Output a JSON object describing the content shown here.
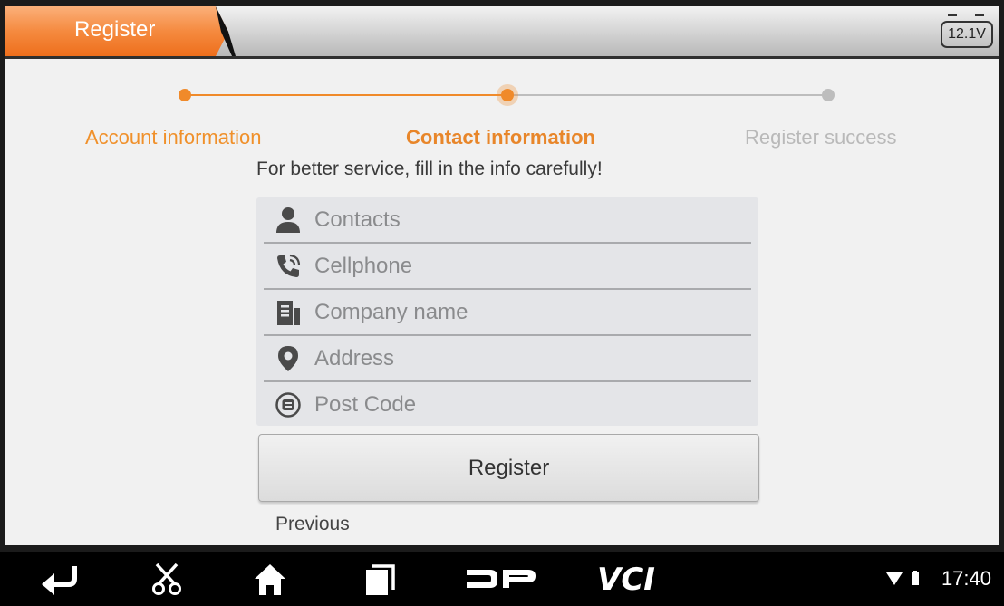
{
  "header": {
    "tab_title": "Register",
    "battery_voltage": "12.1V"
  },
  "stepper": {
    "steps": [
      {
        "label": "Account information",
        "state": "done"
      },
      {
        "label": "Contact information",
        "state": "current"
      },
      {
        "label": "Register success",
        "state": "pending"
      }
    ]
  },
  "form": {
    "hint": "For better service, fill in the info carefully!",
    "fields": [
      {
        "icon": "person-icon",
        "placeholder": "Contacts",
        "value": ""
      },
      {
        "icon": "phone-icon",
        "placeholder": "Cellphone",
        "value": ""
      },
      {
        "icon": "building-icon",
        "placeholder": "Company name",
        "value": ""
      },
      {
        "icon": "location-pin-icon",
        "placeholder": "Address",
        "value": ""
      },
      {
        "icon": "postcode-icon",
        "placeholder": "Post Code",
        "value": ""
      }
    ],
    "register_label": "Register",
    "previous_label": "Previous"
  },
  "navbar": {
    "buttons": [
      "back-icon",
      "screenshot-icon",
      "home-icon",
      "recents-icon",
      "dp-icon",
      "vci-icon"
    ],
    "dp_text": "DP",
    "vci_text": "VCI",
    "time": "17:40"
  },
  "colors": {
    "accent": "#f08a2a",
    "step_pending": "#b9b9b9",
    "form_bg": "#e4e5e8"
  }
}
